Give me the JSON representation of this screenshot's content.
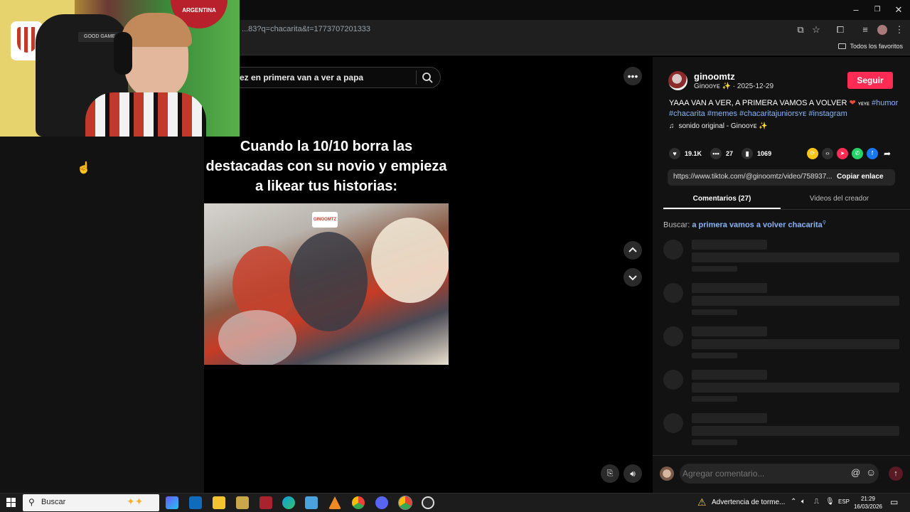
{
  "browser": {
    "url": "...83?q=chacarita&t=1773707201333",
    "bookmarks_label": "Todos los favoritos",
    "window_controls": [
      "–",
      "❐",
      "✕"
    ]
  },
  "page": {
    "search_text": "ez en primera van a ver a papa",
    "video_caption": "Cuando la 10/10 borra las destacadas con su novio y empieza a likear tus historias:",
    "video_watermark": "GINOOMTZ"
  },
  "post": {
    "username": "ginoomtz",
    "display_name": "Ginooʏᴇ ✨",
    "date": "2025-12-29",
    "follow_label": "Seguir",
    "description_text": "YAAA VAN A VER, A PRIMERA VAMOS A VOLVER",
    "description_suffix": "ʏᴇʏᴇ",
    "hashtags": [
      "#humor",
      "#chacarita",
      "#memes",
      "#chacaritajuniorsʏᴇ",
      "#instagram"
    ],
    "sound": "sonido original - Ginooʏᴇ ✨",
    "likes": "19.1K",
    "comments": "27",
    "saves": "1069",
    "link": "https://www.tiktok.com/@ginoomtz/video/758937...",
    "copy_link_label": "Copiar enlace",
    "tab_comments": "Comentarios (27)",
    "tab_creator": "Videos del creador",
    "search_prefix": "Buscar:",
    "search_query": "a primera vamos a volver chacarita",
    "comment_placeholder": "Agregar comentario..."
  },
  "webcam": {
    "cap_label": "GOOD GAME",
    "banner_label": "ARGENTINA"
  },
  "taskbar": {
    "search_placeholder": "Buscar",
    "weather": "Advertencia de torme...",
    "language": "ESP",
    "time": "21:29",
    "date": "16/03/2026"
  },
  "colors": {
    "accent": "#fe2c55",
    "hashtag": "#8ab4f8",
    "panel": "#121212"
  }
}
